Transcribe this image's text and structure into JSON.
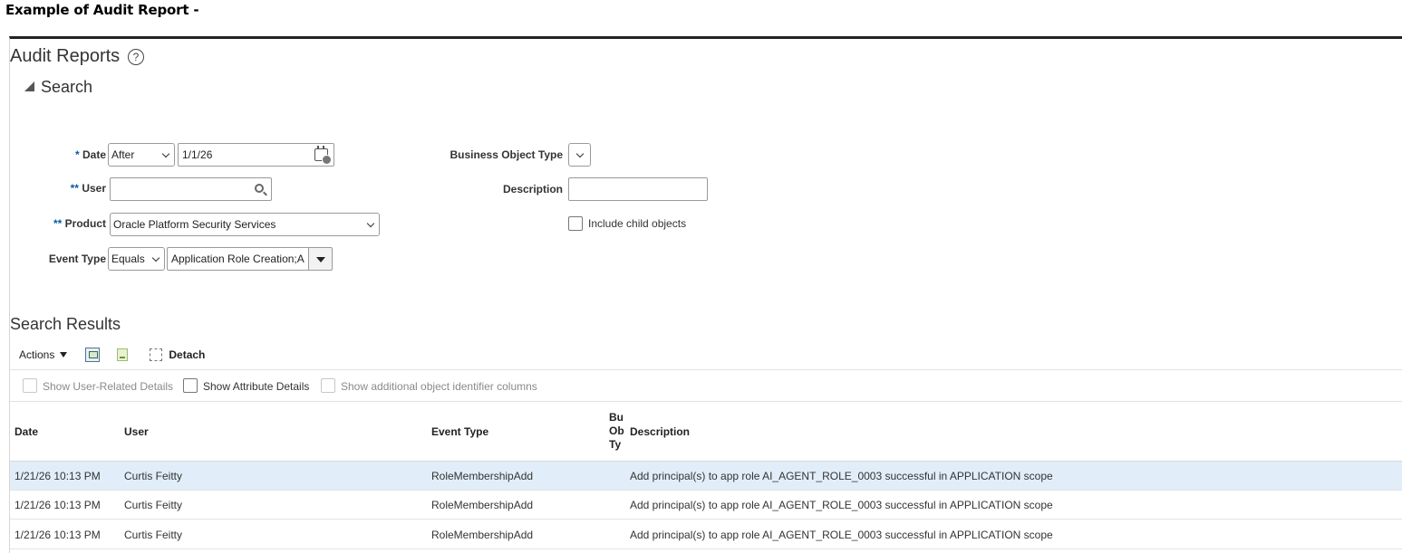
{
  "caption": "Example of Audit Report -",
  "page": {
    "title": "Audit Reports",
    "help_icon": "?"
  },
  "search": {
    "toggle_label": "Search",
    "fields": {
      "date": {
        "required_marker": "*",
        "label": "Date",
        "operator": "After",
        "value": "1/1/26"
      },
      "user": {
        "required_marker": "**",
        "label": "User",
        "value": ""
      },
      "product": {
        "required_marker": "**",
        "label": "Product",
        "value": "Oracle Platform Security Services"
      },
      "event_type": {
        "label": "Event Type",
        "operator": "Equals",
        "value": "Application Role Creation;A"
      },
      "business_object_type": {
        "label": "Business Object Type",
        "value": ""
      },
      "description": {
        "label": "Description",
        "value": ""
      },
      "include_child_objects": {
        "label": "Include child objects",
        "checked": false
      }
    }
  },
  "results": {
    "title": "Search Results",
    "toolbar": {
      "actions_label": "Actions",
      "detach_label": "Detach"
    },
    "options": [
      {
        "label": "Show User-Related Details",
        "enabled": false,
        "checked": false
      },
      {
        "label": "Show Attribute Details",
        "enabled": true,
        "checked": false
      },
      {
        "label": "Show additional object identifier columns",
        "enabled": false,
        "checked": false
      }
    ],
    "columns": {
      "date": "Date",
      "user": "User",
      "event_type": "Event Type",
      "bo_type_line1": "Bu",
      "bo_type_line2": "Ob",
      "bo_type_line3": "Ty",
      "description": "Description"
    },
    "rows": [
      {
        "date": "1/21/26 10:13 PM",
        "user": "Curtis Feitty",
        "event_type": "RoleMembershipAdd",
        "description": "Add principal(s) to app role AI_AGENT_ROLE_0003 successful in APPLICATION scope",
        "selected": true
      },
      {
        "date": "1/21/26 10:13 PM",
        "user": "Curtis Feitty",
        "event_type": "RoleMembershipAdd",
        "description": "Add principal(s) to app role AI_AGENT_ROLE_0003 successful in APPLICATION scope",
        "selected": false
      },
      {
        "date": "1/21/26 10:13 PM",
        "user": "Curtis Feitty",
        "event_type": "RoleMembershipAdd",
        "description": "Add principal(s) to app role AI_AGENT_ROLE_0003 successful in APPLICATION scope",
        "selected": false
      }
    ]
  },
  "colors": {
    "required_marker": "#0a5aa8",
    "selected_row": "#e1eef9",
    "frame_top_border": "#222222"
  }
}
